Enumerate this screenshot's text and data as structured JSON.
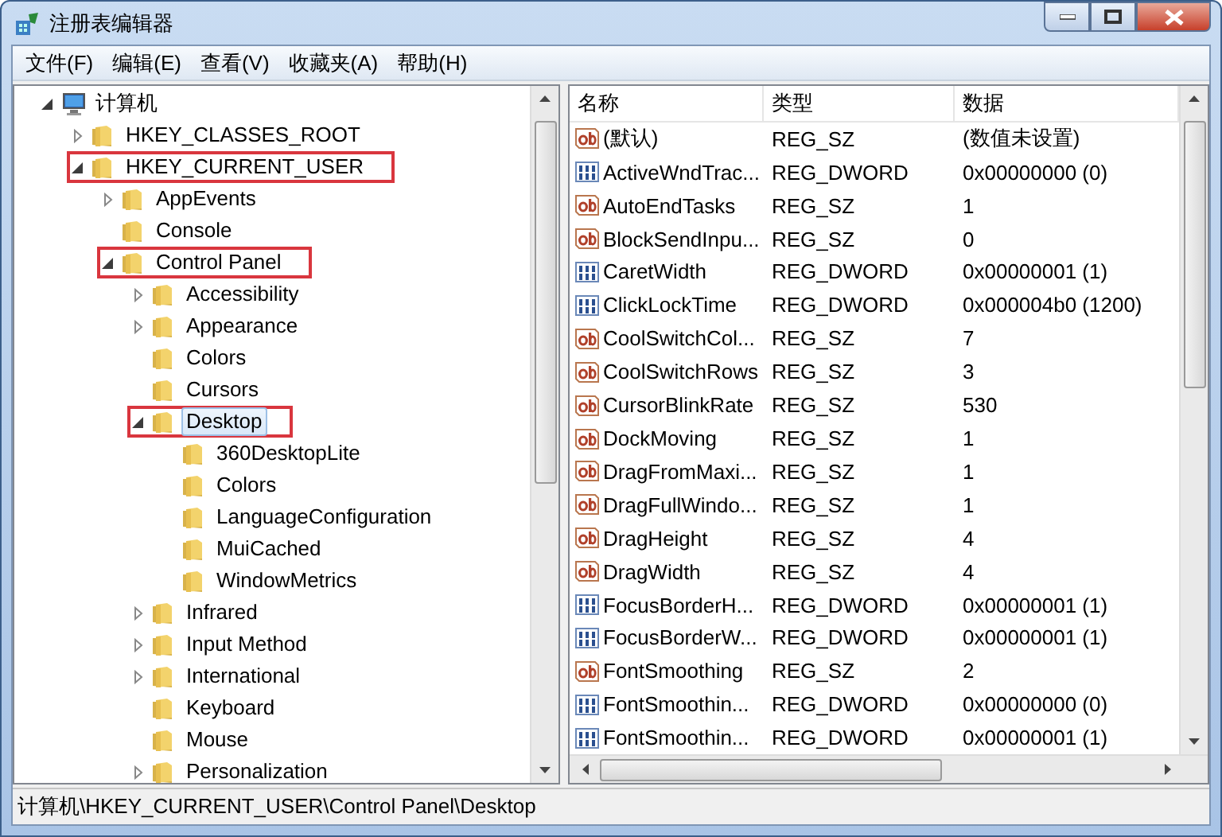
{
  "window": {
    "title": "注册表编辑器"
  },
  "menu": [
    "文件(F)",
    "编辑(E)",
    "查看(V)",
    "收藏夹(A)",
    "帮助(H)"
  ],
  "tree": [
    {
      "label": "计算机",
      "kind": "computer",
      "expanded": true,
      "selected": false,
      "highlighted": false,
      "children": [
        {
          "label": "HKEY_CLASSES_ROOT",
          "kind": "folder",
          "expanded": false,
          "selected": false,
          "highlighted": false
        },
        {
          "label": "HKEY_CURRENT_USER",
          "kind": "folder",
          "expanded": true,
          "selected": false,
          "highlighted": true,
          "children": [
            {
              "label": "AppEvents",
              "kind": "folder",
              "expanded": false,
              "selected": false,
              "highlighted": false
            },
            {
              "label": "Console",
              "kind": "folder",
              "selected": false,
              "highlighted": false
            },
            {
              "label": "Control Panel",
              "kind": "folder",
              "expanded": true,
              "selected": false,
              "highlighted": true,
              "children": [
                {
                  "label": "Accessibility",
                  "kind": "folder",
                  "expanded": false,
                  "selected": false,
                  "highlighted": false
                },
                {
                  "label": "Appearance",
                  "kind": "folder",
                  "expanded": false,
                  "selected": false,
                  "highlighted": false
                },
                {
                  "label": "Colors",
                  "kind": "folder",
                  "selected": false,
                  "highlighted": false
                },
                {
                  "label": "Cursors",
                  "kind": "folder",
                  "selected": false,
                  "highlighted": false
                },
                {
                  "label": "Desktop",
                  "kind": "folder",
                  "expanded": true,
                  "selected": true,
                  "highlighted": true,
                  "children": [
                    {
                      "label": "360DesktopLite",
                      "kind": "folder",
                      "selected": false,
                      "highlighted": false
                    },
                    {
                      "label": "Colors",
                      "kind": "folder",
                      "selected": false,
                      "highlighted": false
                    },
                    {
                      "label": "LanguageConfiguration",
                      "kind": "folder",
                      "selected": false,
                      "highlighted": false
                    },
                    {
                      "label": "MuiCached",
                      "kind": "folder",
                      "selected": false,
                      "highlighted": false
                    },
                    {
                      "label": "WindowMetrics",
                      "kind": "folder",
                      "selected": false,
                      "highlighted": false
                    }
                  ]
                },
                {
                  "label": "Infrared",
                  "kind": "folder",
                  "expanded": false,
                  "selected": false,
                  "highlighted": false
                },
                {
                  "label": "Input Method",
                  "kind": "folder",
                  "expanded": false,
                  "selected": false,
                  "highlighted": false
                },
                {
                  "label": "International",
                  "kind": "folder",
                  "expanded": false,
                  "selected": false,
                  "highlighted": false
                },
                {
                  "label": "Keyboard",
                  "kind": "folder",
                  "selected": false,
                  "highlighted": false
                },
                {
                  "label": "Mouse",
                  "kind": "folder",
                  "selected": false,
                  "highlighted": false
                },
                {
                  "label": "Personalization",
                  "kind": "folder",
                  "expanded": false,
                  "selected": false,
                  "highlighted": false
                }
              ]
            }
          ]
        }
      ]
    }
  ],
  "table": {
    "columns": [
      "名称",
      "类型",
      "数据"
    ],
    "rows": [
      {
        "kind": "string",
        "name": "(默认)",
        "type": "REG_SZ",
        "data": "(数值未设置)"
      },
      {
        "kind": "binary",
        "name": "ActiveWndTrac...",
        "type": "REG_DWORD",
        "data": "0x00000000 (0)"
      },
      {
        "kind": "string",
        "name": "AutoEndTasks",
        "type": "REG_SZ",
        "data": "1"
      },
      {
        "kind": "string",
        "name": "BlockSendInpu...",
        "type": "REG_SZ",
        "data": "0"
      },
      {
        "kind": "binary",
        "name": "CaretWidth",
        "type": "REG_DWORD",
        "data": "0x00000001 (1)"
      },
      {
        "kind": "binary",
        "name": "ClickLockTime",
        "type": "REG_DWORD",
        "data": "0x000004b0 (1200)"
      },
      {
        "kind": "string",
        "name": "CoolSwitchCol...",
        "type": "REG_SZ",
        "data": "7"
      },
      {
        "kind": "string",
        "name": "CoolSwitchRows",
        "type": "REG_SZ",
        "data": "3"
      },
      {
        "kind": "string",
        "name": "CursorBlinkRate",
        "type": "REG_SZ",
        "data": "530"
      },
      {
        "kind": "string",
        "name": "DockMoving",
        "type": "REG_SZ",
        "data": "1"
      },
      {
        "kind": "string",
        "name": "DragFromMaxi...",
        "type": "REG_SZ",
        "data": "1"
      },
      {
        "kind": "string",
        "name": "DragFullWindo...",
        "type": "REG_SZ",
        "data": "1"
      },
      {
        "kind": "string",
        "name": "DragHeight",
        "type": "REG_SZ",
        "data": "4"
      },
      {
        "kind": "string",
        "name": "DragWidth",
        "type": "REG_SZ",
        "data": "4"
      },
      {
        "kind": "binary",
        "name": "FocusBorderH...",
        "type": "REG_DWORD",
        "data": "0x00000001 (1)"
      },
      {
        "kind": "binary",
        "name": "FocusBorderW...",
        "type": "REG_DWORD",
        "data": "0x00000001 (1)"
      },
      {
        "kind": "string",
        "name": "FontSmoothing",
        "type": "REG_SZ",
        "data": "2"
      },
      {
        "kind": "binary",
        "name": "FontSmoothin...",
        "type": "REG_DWORD",
        "data": "0x00000000 (0)"
      },
      {
        "kind": "binary",
        "name": "FontSmoothin...",
        "type": "REG_DWORD",
        "data": "0x00000001 (1)"
      }
    ]
  },
  "status_bar": "计算机\\HKEY_CURRENT_USER\\Control Panel\\Desktop"
}
